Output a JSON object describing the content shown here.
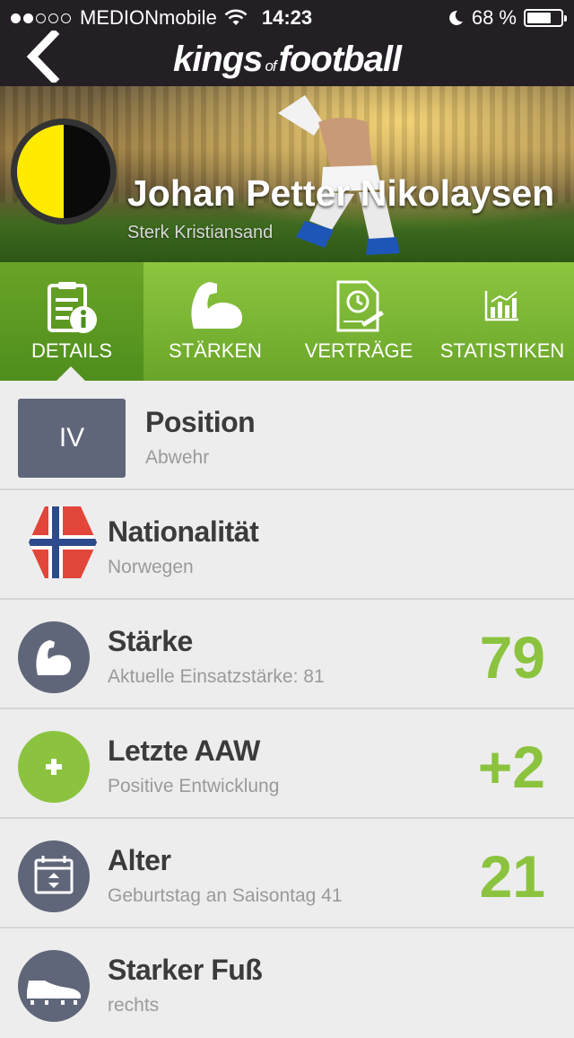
{
  "status_bar": {
    "carrier": "MEDIONmobile",
    "time": "14:23",
    "battery": "68 %",
    "battery_level": 0.68,
    "signal_dots_filled": 2,
    "signal_dots_total": 5
  },
  "nav": {
    "brand_left": "kings",
    "brand_of": "of",
    "brand_right": "football",
    "back_icon": "chevron-left-icon"
  },
  "player": {
    "name": "Johan Petter Nikolaysen",
    "club": "Sterk Kristiansand",
    "club_colors": [
      "#ffea00",
      "#0a0a0a"
    ]
  },
  "tabs": [
    {
      "label": "DETAILS",
      "icon": "document-info-icon",
      "active": true
    },
    {
      "label": "STÄRKEN",
      "icon": "biceps-icon",
      "active": false
    },
    {
      "label": "VERTRÄGE",
      "icon": "contract-clock-icon",
      "active": false
    },
    {
      "label": "STATISTIKEN",
      "icon": "chart-icon",
      "active": false
    }
  ],
  "details": {
    "position": {
      "badge": "IV",
      "title": "Position",
      "subtitle": "Abwehr"
    },
    "nationality": {
      "title": "Nationalität",
      "subtitle": "Norwegen",
      "icon": "norway-flag-icon"
    },
    "strength": {
      "title": "Stärke",
      "subtitle": "Aktuelle Einsatzstärke: 81",
      "value": "79",
      "icon": "biceps-icon"
    },
    "last_aaw": {
      "title": "Letzte AAW",
      "subtitle": "Positive Entwicklung",
      "value": "+2",
      "icon": "plus-icon"
    },
    "age": {
      "title": "Alter",
      "subtitle": "Geburtstag an Saisontag 41",
      "value": "21",
      "icon": "calendar-icon"
    },
    "strong_foot": {
      "title": "Starker Fuß",
      "subtitle": "rechts",
      "icon": "football-boot-icon"
    }
  },
  "colors": {
    "accent_green": "#8bc33f",
    "nav_dark": "#231f25",
    "icon_slate": "#5f6679"
  }
}
